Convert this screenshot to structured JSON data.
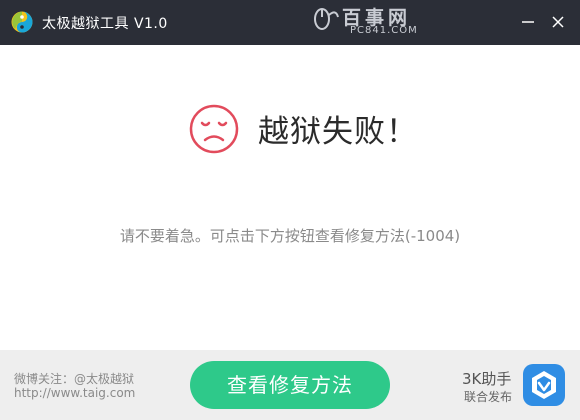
{
  "window": {
    "title": "太极越狱工具 V1.0",
    "watermark_main": "百事网",
    "watermark_sub": "PC841.COM"
  },
  "content": {
    "headline": "越狱失败！",
    "hint": "请不要着急。可点击下方按钮查看修复方法(-1004)"
  },
  "footer": {
    "weibo": "微博关注：@太极越狱",
    "website": "http://www.taig.com",
    "fix_button_label": "查看修复方法",
    "helper_name": "3K助手",
    "helper_sub": "联合发布"
  },
  "colors": {
    "titlebar": "#2b2e37",
    "accent_green": "#2ec98a",
    "sad_red": "#e24b5c",
    "helper_blue": "#2f8de4"
  },
  "icons": {
    "logo": "taichi-logo-icon",
    "minimize": "minimize-icon",
    "close": "close-icon",
    "sad": "sad-face-icon",
    "helper": "3k-helper-app-icon"
  }
}
